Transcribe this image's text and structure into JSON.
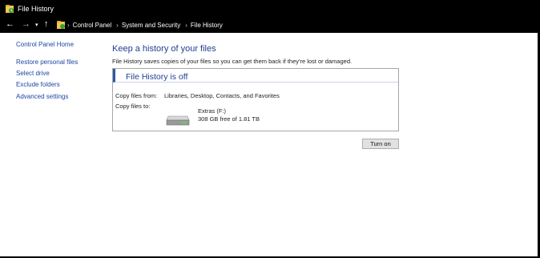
{
  "window": {
    "title": "File History"
  },
  "address": {
    "back_glyph": "←",
    "forward_glyph": "→",
    "recent_glyph": "▾",
    "up_glyph": "↑",
    "separator": "›",
    "crumbs": [
      "Control Panel",
      "System and Security",
      "File History"
    ]
  },
  "sidebar": {
    "home": "Control Panel Home",
    "items": [
      "Restore personal files",
      "Select drive",
      "Exclude folders",
      "Advanced settings"
    ]
  },
  "main": {
    "title": "Keep a history of your files",
    "description": "File History saves copies of your files so you can get them back if they're lost or damaged.",
    "status": "File History is off",
    "copy_from_label": "Copy files from:",
    "copy_from_value": "Libraries, Desktop, Contacts, and Favorites",
    "copy_to_label": "Copy files to:",
    "drive_name": "Extras (F:)",
    "drive_space": "308 GB free of 1.81 TB",
    "turn_on_label": "Turn on"
  },
  "icons": {
    "app": "file-history-icon",
    "drive": "hard-drive-icon"
  },
  "colors": {
    "link": "#1f47a4",
    "heading": "#1e3f8f",
    "chrome": "#000000"
  }
}
